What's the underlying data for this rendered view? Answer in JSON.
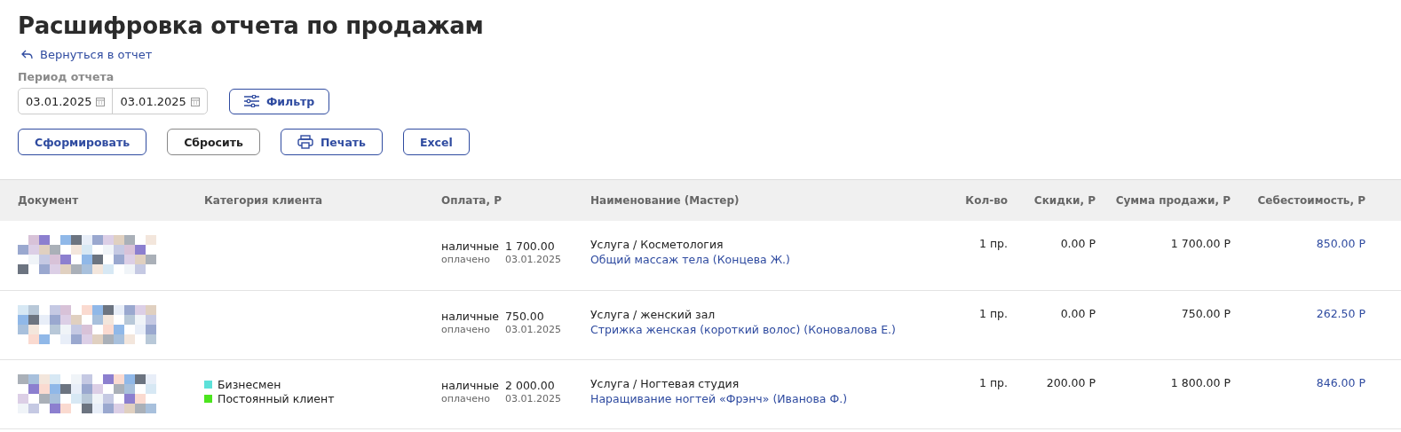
{
  "title": "Расшифровка отчета по продажам",
  "back_link": "Вернуться в отчет",
  "period": {
    "label": "Период отчета",
    "from": "03.01.2025",
    "to": "03.01.2025"
  },
  "filter_button": "Фильтр",
  "actions": [
    {
      "label": "Сформировать",
      "kind": "primary"
    },
    {
      "label": "Сбросить",
      "kind": "secondary"
    },
    {
      "label": "Печать",
      "kind": "print"
    },
    {
      "label": "Excel",
      "kind": "primary"
    }
  ],
  "table": {
    "columns": [
      "Документ",
      "Категория клиента",
      "Оплата, Р",
      "Наименование (Мастер)",
      "Кол-во",
      "Скидки, Р",
      "Сумма продажи, Р",
      "Себестоимость, Р"
    ],
    "rows": [
      {
        "document": {
          "kind": "picture"
        },
        "categories": [],
        "payment": {
          "method": "наличные",
          "amount": "1 700.00",
          "status": "оплачено",
          "date": "03.01.2025"
        },
        "service": "Услуга / Косметология",
        "item": "Общий массаж тела (Концева Ж.)",
        "qty": "1 пр.",
        "discount": "0.00 Р",
        "total": "1 700.00 Р",
        "cost": "850.00 Р"
      },
      {
        "document": {
          "kind": "picture"
        },
        "categories": [],
        "payment": {
          "method": "наличные",
          "amount": "750.00",
          "status": "оплачено",
          "date": "03.01.2025"
        },
        "service": "Услуга / женский зал",
        "item": "Стрижка женская (короткий волос) (Коновалова Е.)",
        "qty": "1 пр.",
        "discount": "0.00 Р",
        "total": "750.00 Р",
        "cost": "262.50 Р"
      },
      {
        "document": {
          "kind": "picture"
        },
        "categories": [
          {
            "label": "Бизнесмен",
            "color": "#5ce1d9"
          },
          {
            "label": "Постоянный клиент",
            "color": "#4ce51e"
          }
        ],
        "payment": {
          "method": "наличные",
          "amount": "2 000.00",
          "status": "оплачено",
          "date": "03.01.2025"
        },
        "service": "Услуга / Ногтевая студия",
        "item": "Наращивание ногтей «Фрэнч» (Иванова Ф.)",
        "qty": "1 пр.",
        "discount": "200.00 Р",
        "total": "1 800.00 Р",
        "cost": "846.00 Р"
      }
    ]
  }
}
